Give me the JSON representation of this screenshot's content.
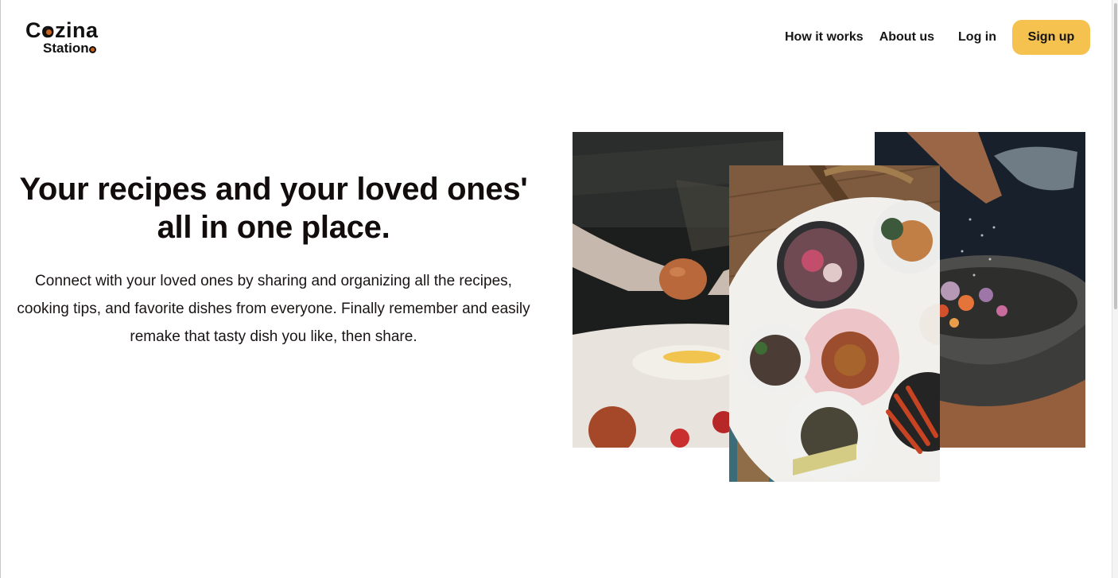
{
  "brand": {
    "line1": "Cozina",
    "line2": "Station"
  },
  "nav": {
    "how_it_works": "How it works",
    "about_us": "About us",
    "log_in": "Log in",
    "sign_up": "Sign up"
  },
  "hero": {
    "title": "Your recipes and your loved ones' all in one place.",
    "description": "Connect with your loved ones by sharing and organizing all the recipes, cooking tips, and favorite dishes from everyone. Finally remember and easily remake that tasty dish you like, then share."
  },
  "colors": {
    "accent": "#f5c14f",
    "logo_dot": "#c9641f",
    "text": "#140f0f"
  }
}
